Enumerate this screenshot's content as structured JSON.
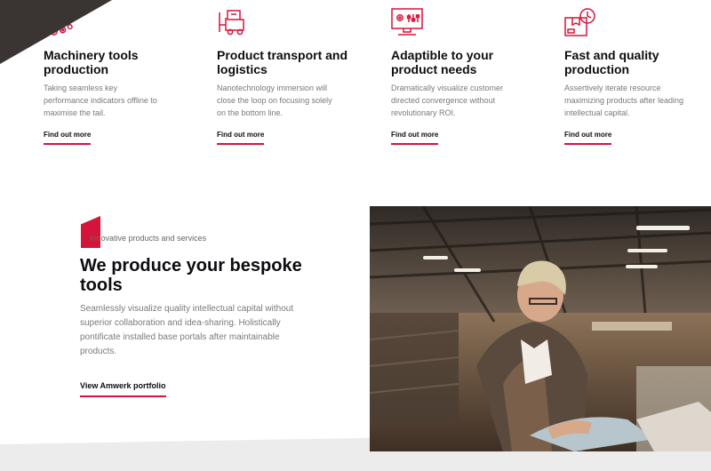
{
  "features": [
    {
      "icon": "gears-icon",
      "title": "Machinery tools production",
      "text": "Taking seamless key performance indicators offline to maximise the tail.",
      "link": "Find out more"
    },
    {
      "icon": "forklift-icon",
      "title": "Product transport and logistics",
      "text": "Nanotechnology immersion will close the loop on focusing solely on the bottom line.",
      "link": "Find out more"
    },
    {
      "icon": "monitor-settings-icon",
      "title": "Adaptible to your product needs",
      "text": "Dramatically visualize customer directed convergence without revolutionary ROI.",
      "link": "Find out more"
    },
    {
      "icon": "box-clock-icon",
      "title": "Fast and quality production",
      "text": "Assertively iterate resource maximizing products after leading intellectual capital.",
      "link": "Find out more"
    }
  ],
  "about": {
    "kicker": "Innovative products and services",
    "headline": "We produce your bespoke tools",
    "description": "Seamlessly visualize quality intellectual capital without superior collaboration and idea-sharing. Holistically pontificate installed base portals after maintainable products.",
    "link": "View Amwerk portfolio",
    "photo": "woman-working-in-workshop-photo"
  },
  "colors": {
    "accent": "#d5143a",
    "heading": "#0d0d12",
    "body_text": "#7a7a7a",
    "dark_shape": "#3a3532",
    "grey_band": "#ececec"
  }
}
